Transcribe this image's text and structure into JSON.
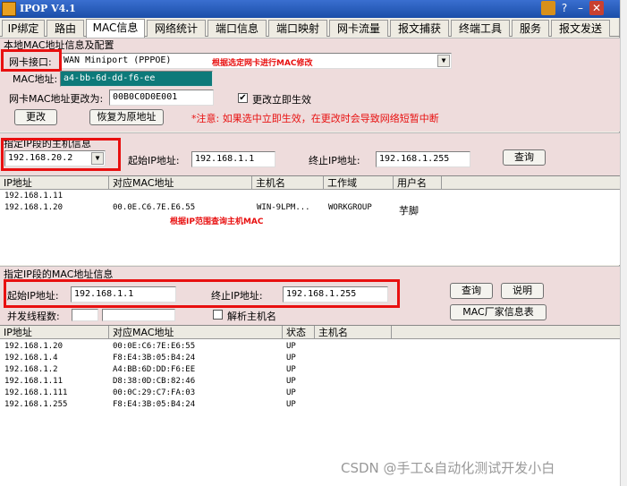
{
  "window": {
    "title": "IPOP V4.1",
    "help_glyph": "?",
    "minimize_glyph": "–",
    "close_glyph": "✕"
  },
  "tabs": [
    {
      "label": "IP绑定"
    },
    {
      "label": "路由"
    },
    {
      "label": "MAC信息"
    },
    {
      "label": "网络统计"
    },
    {
      "label": "端口信息"
    },
    {
      "label": "端口映射"
    },
    {
      "label": "网卡流量"
    },
    {
      "label": "报文捕获"
    },
    {
      "label": "终端工具"
    },
    {
      "label": "服务"
    },
    {
      "label": "报文发送"
    }
  ],
  "mac_config": {
    "group_label": "本地MAC地址信息及配置",
    "nic_label": "网卡接口:",
    "nic_value": "WAN Miniport (PPPOE)",
    "nic_note": "根据选定网卡进行MAC修改",
    "mac_label": "MAC地址:",
    "mac_value": "a4-bb-6d-dd-f6-ee",
    "change_label": "网卡MAC地址更改为:",
    "change_value": "00B0C0D0E001",
    "immediate_label": "更改立即生效",
    "immediate_checked": "✔",
    "change_button": "更改",
    "restore_button": "恢复为原地址",
    "warning": "*注意: 如果选中立即生效，在更改时会导致网络短暂中断"
  },
  "ip_segment": {
    "group_label": "指定IP段的主机信息",
    "segment_value": "192.168.20.2",
    "start_label": "起始IP地址:",
    "start_value": "192.168.1.1",
    "end_label": "终止IP地址:",
    "end_value": "192.168.1.255",
    "query_button": "查询",
    "columns": [
      "IP地址",
      "对应MAC地址",
      "主机名",
      "工作域",
      "用户名"
    ],
    "rows": [
      [
        "192.168.1.11",
        "",
        "",
        "",
        ""
      ],
      [
        "192.168.1.20",
        "00.0E.C6.7E.E6.55",
        "WIN-9LPM...",
        "WORKGROUP",
        "芋脚"
      ]
    ],
    "note": "根据IP范围查询主机MAC"
  },
  "mac_segment": {
    "group_label": "指定IP段的MAC地址信息",
    "start_label": "起始IP地址:",
    "start_value": "192.168.1.1",
    "end_label": "终止IP地址:",
    "end_value": "192.168.1.255",
    "query_button": "查询",
    "explain_button": "说明",
    "vendor_button": "MAC厂家信息表",
    "threads_label": "并发线程数:",
    "resolve_label": "解析主机名",
    "columns": [
      "IP地址",
      "对应MAC地址",
      "状态",
      "主机名"
    ],
    "rows": [
      [
        "192.168.1.20",
        "00:0E:C6:7E:E6:55",
        "UP",
        ""
      ],
      [
        "192.168.1.4",
        "F8:E4:3B:05:B4:24",
        "UP",
        ""
      ],
      [
        "192.168.1.2",
        "A4:BB:6D:DD:F6:EE",
        "UP",
        ""
      ],
      [
        "192.168.1.11",
        "D8:38:0D:CB:82:46",
        "UP",
        ""
      ],
      [
        "192.168.1.111",
        "00:0C:29:C7:FA:03",
        "UP",
        ""
      ],
      [
        "192.168.1.255",
        "F8:E4:3B:05:B4:24",
        "UP",
        ""
      ]
    ]
  },
  "watermark": "CSDN @手工&自动化测试开发小白"
}
